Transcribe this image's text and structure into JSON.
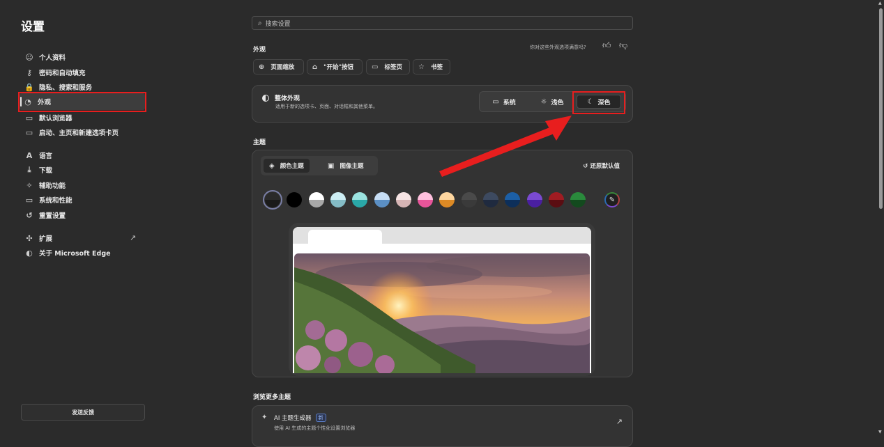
{
  "app_title": "设置",
  "sidebar": {
    "items": [
      {
        "icon": "profile-icon",
        "glyph": "☺",
        "label": "个人资料"
      },
      {
        "icon": "key-icon",
        "glyph": "⚷",
        "label": "密码和自动填充"
      },
      {
        "icon": "lock-icon",
        "glyph": "🔒",
        "label": "隐私、搜索和服务"
      },
      {
        "icon": "palette-icon",
        "glyph": "◔",
        "label": "外观",
        "active": true
      },
      {
        "icon": "browser-icon",
        "glyph": "▭",
        "label": "默认浏览器"
      },
      {
        "icon": "home-tab-icon",
        "glyph": "▭",
        "label": "启动、主页和新建选项卡页"
      },
      {
        "icon": "language-icon",
        "glyph": "A",
        "label": "语言"
      },
      {
        "icon": "download-icon",
        "glyph": "⤓",
        "label": "下载"
      },
      {
        "icon": "accessibility-icon",
        "glyph": "✧",
        "label": "辅助功能"
      },
      {
        "icon": "laptop-icon",
        "glyph": "▭",
        "label": "系统和性能"
      },
      {
        "icon": "reset-icon",
        "glyph": "↺",
        "label": "重置设置"
      },
      {
        "icon": "puzzle-icon",
        "glyph": "✣",
        "label": "扩展"
      },
      {
        "icon": "edge-logo-icon",
        "glyph": "◐",
        "label": "关于 Microsoft Edge"
      }
    ],
    "feedback_label": "发送反馈"
  },
  "search": {
    "placeholder": "搜索设置"
  },
  "appearance": {
    "section_title": "外观",
    "feedback_question": "你对这些外观选项满意吗?",
    "chips": [
      {
        "icon": "zoom-icon",
        "glyph": "⊕",
        "label": "页面缩放"
      },
      {
        "icon": "home-icon",
        "glyph": "⌂",
        "label": "\"开始\"按钮"
      },
      {
        "icon": "tab-page-icon",
        "glyph": "▭",
        "label": "标签页"
      },
      {
        "icon": "favorites-icon",
        "glyph": "☆",
        "label": "书签"
      }
    ],
    "overall": {
      "title": "整体外观",
      "desc": "适用于新的选项卡、页面、对话框和其他菜单。",
      "options": [
        {
          "icon": "laptop-icon",
          "glyph": "▭",
          "label": "系统"
        },
        {
          "icon": "sun-icon",
          "glyph": "☼",
          "label": "浅色"
        },
        {
          "icon": "moon-icon",
          "glyph": "☾",
          "label": "深色",
          "selected": true
        }
      ]
    }
  },
  "theme": {
    "section_title": "主题",
    "tabs": [
      {
        "icon": "paint-bucket-icon",
        "glyph": "◈",
        "label": "颜色主题",
        "selected": true
      },
      {
        "icon": "image-icon",
        "glyph": "▣",
        "label": "图像主题"
      }
    ],
    "restore_label": "还原默认值",
    "swatches": [
      {
        "top": "#2a2a2a",
        "bottom": "#1a1a1a",
        "selected": true
      },
      {
        "top": "#000000",
        "bottom": "#000000"
      },
      {
        "top": "#ffffff",
        "bottom": "#a8a8a8"
      },
      {
        "top": "#cdeef4",
        "bottom": "#84bcc6"
      },
      {
        "top": "#9be3e0",
        "bottom": "#2aa8a8"
      },
      {
        "top": "#c7def5",
        "bottom": "#5b8fc4"
      },
      {
        "top": "#f6e4e4",
        "bottom": "#d6b5b5"
      },
      {
        "top": "#ffc0de",
        "bottom": "#e8559a"
      },
      {
        "top": "#ffd7a0",
        "bottom": "#dd8a25"
      },
      {
        "top": "#4a4a4a",
        "bottom": "#3a3a3a"
      },
      {
        "top": "#3d4a60",
        "bottom": "#1f2a3f"
      },
      {
        "top": "#1c5fa6",
        "bottom": "#0d2f5a"
      },
      {
        "top": "#7a4ad1",
        "bottom": "#4a1fa0"
      },
      {
        "top": "#a01c22",
        "bottom": "#5a0d12"
      },
      {
        "top": "#2a8a3c",
        "bottom": "#134a1e"
      }
    ],
    "custom_icon": "eyedropper-icon"
  },
  "more_themes": {
    "section_title": "浏览更多主题",
    "ai_title": "AI 主题生成器",
    "ai_badge": "新",
    "ai_desc": "使用 AI 生成的主题个性化设置浏览器"
  }
}
